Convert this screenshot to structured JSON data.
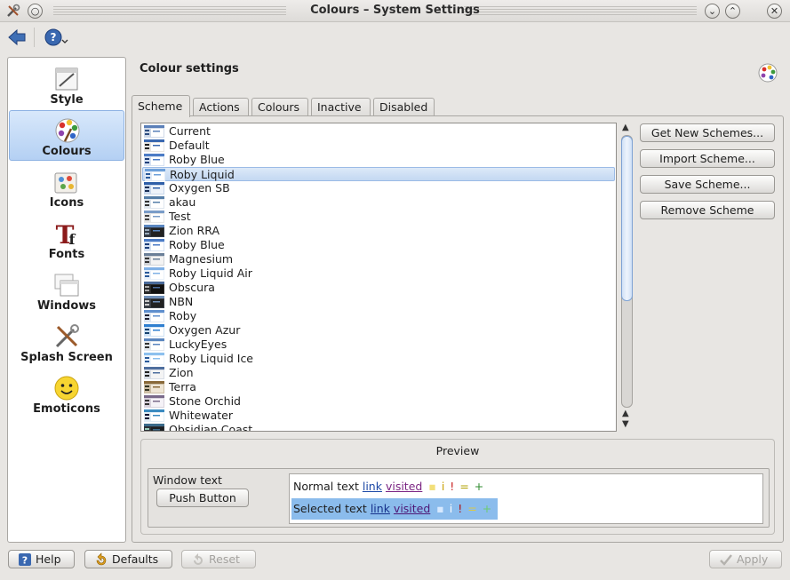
{
  "window": {
    "title": "Colours – System Settings"
  },
  "sidebar": {
    "items": [
      {
        "label": "Style",
        "icon": "style-icon"
      },
      {
        "label": "Colours",
        "icon": "colours-icon"
      },
      {
        "label": "Icons",
        "icon": "icons-icon"
      },
      {
        "label": "Fonts",
        "icon": "fonts-icon"
      },
      {
        "label": "Windows",
        "icon": "windows-icon"
      },
      {
        "label": "Splash Screen",
        "icon": "splash-screen-icon"
      },
      {
        "label": "Emoticons",
        "icon": "emoticons-icon"
      }
    ],
    "selected": "Colours"
  },
  "main": {
    "title": "Colour settings",
    "tabs": [
      {
        "label": "Scheme",
        "active": true
      },
      {
        "label": "Actions"
      },
      {
        "label": "Colours"
      },
      {
        "label": "Inactive"
      },
      {
        "label": "Disabled"
      }
    ],
    "schemes": [
      "Current",
      "Default",
      "Roby Blue",
      "Roby Liquid",
      "Oxygen SB",
      "akau",
      "Test",
      "Zion RRA",
      "Roby Blue",
      "Magnesium",
      "Roby Liquid Air",
      "Obscura",
      "NBN",
      "Roby",
      "Oxygen Azur",
      "LuckyEyes",
      "Roby Liquid Ice",
      "Zion",
      "Terra",
      "Stone Orchid",
      "Whitewater",
      "Obsidian Coast"
    ],
    "selected_scheme": "Roby Liquid",
    "scheme_buttons": {
      "get_new": "Get New Schemes...",
      "import": "Import Scheme...",
      "save": "Save Scheme...",
      "remove": "Remove Scheme"
    }
  },
  "preview": {
    "title": "Preview",
    "window_text": "Window text",
    "push_button": "Push Button",
    "normal_text": "Normal text",
    "selected_text": "Selected text",
    "link": "link",
    "visited": "visited",
    "symbols": [
      "i",
      "!",
      "=",
      "+"
    ]
  },
  "footer": {
    "help": "Help",
    "defaults": "Defaults",
    "reset": "Reset",
    "apply": "Apply"
  },
  "colors": {
    "selection": "#b4d0f3",
    "link": "#1c48a6",
    "visited": "#7a2382",
    "selected_bg": "#8bbcec"
  }
}
